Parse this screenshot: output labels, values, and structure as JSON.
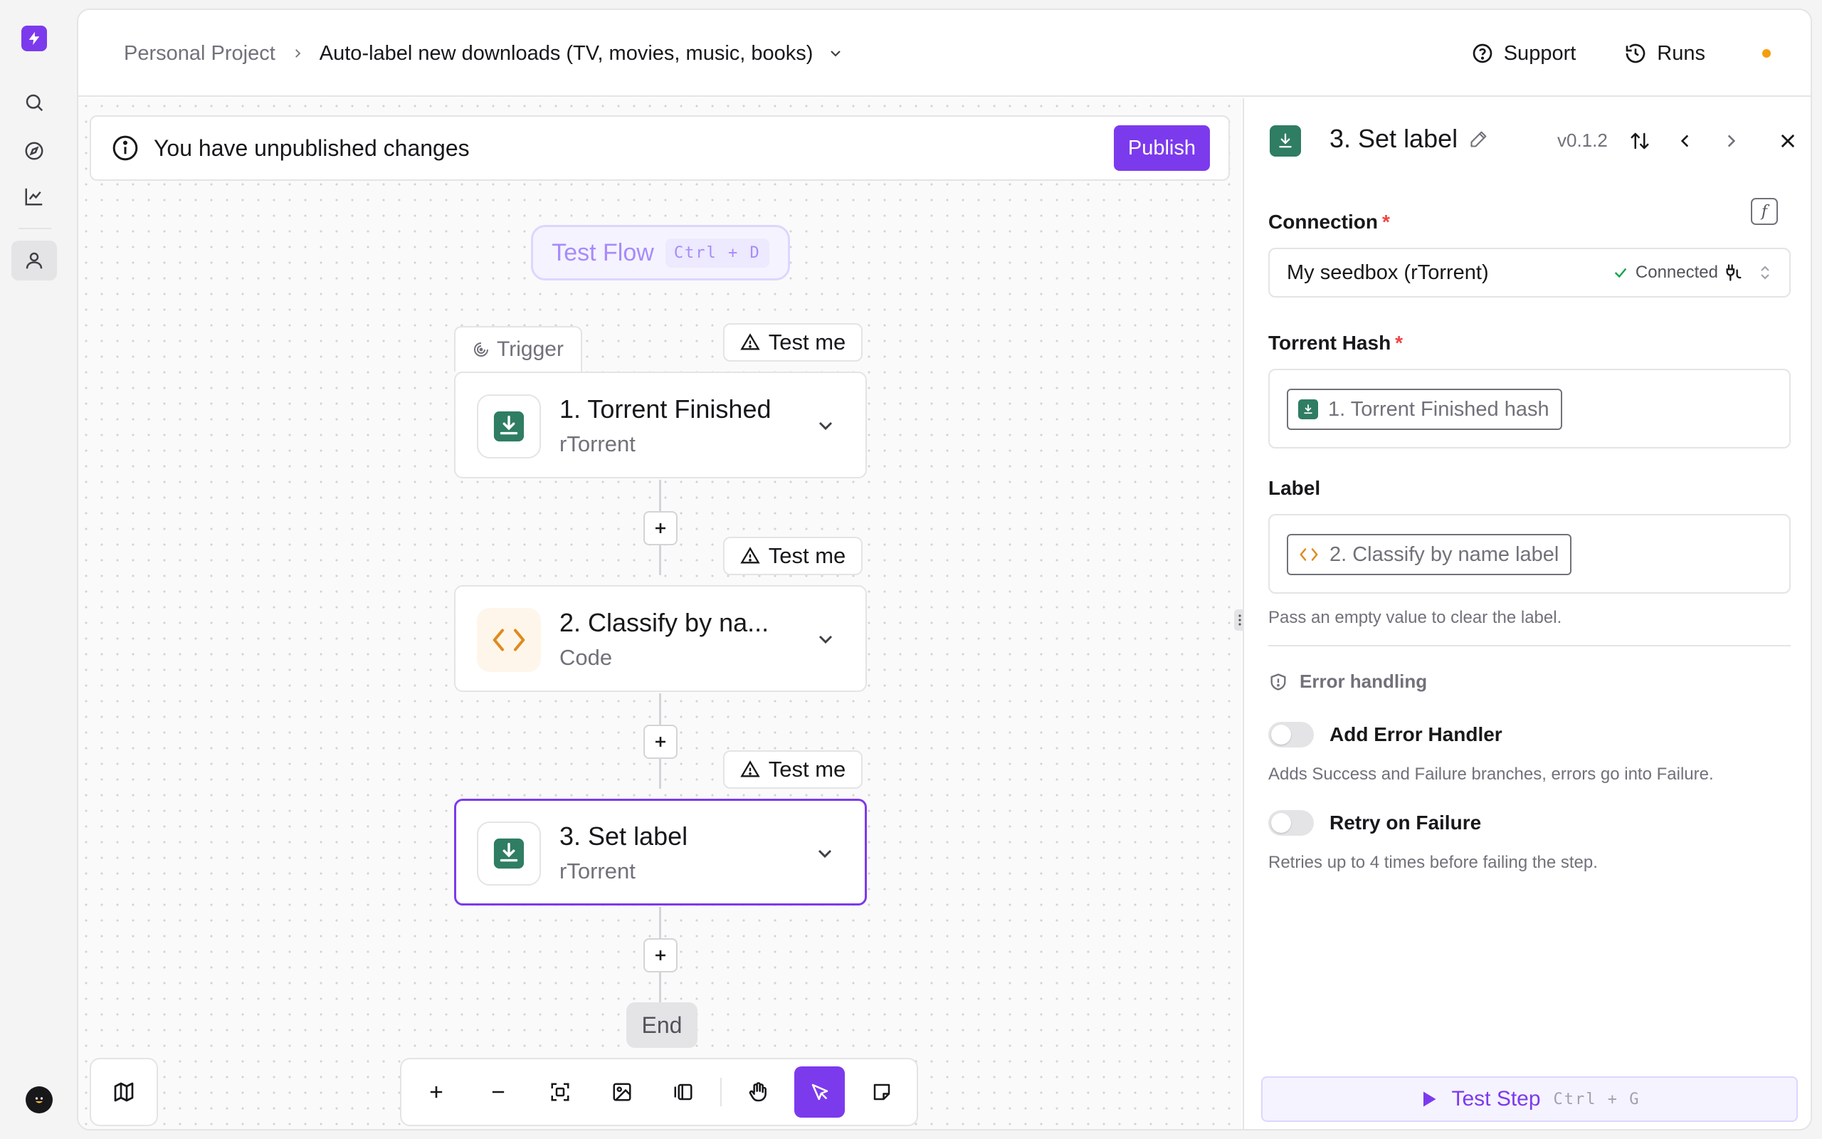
{
  "breadcrumb": {
    "project": "Personal Project",
    "flow_name": "Auto-label new downloads (TV, movies, music, books)"
  },
  "header": {
    "support_label": "Support",
    "runs_label": "Runs"
  },
  "banner": {
    "message": "You have unpublished changes",
    "publish_label": "Publish"
  },
  "canvas": {
    "test_flow_label": "Test Flow",
    "test_flow_shortcut": "Ctrl + D",
    "trigger_tab_label": "Trigger",
    "test_me_label": "Test me",
    "end_label": "End",
    "steps": [
      {
        "title": "1. Torrent Finished",
        "subtitle": "rTorrent",
        "icon": "download-icon"
      },
      {
        "title": "2. Classify by na...",
        "subtitle": "Code",
        "icon": "code-icon"
      },
      {
        "title": "3. Set label",
        "subtitle": "rTorrent",
        "icon": "download-icon",
        "selected": true
      }
    ]
  },
  "panel": {
    "title": "3. Set label",
    "version": "v0.1.2",
    "connection": {
      "label": "Connection",
      "required_mark": "*",
      "value": "My seedbox (rTorrent)",
      "status": "Connected"
    },
    "torrent_hash": {
      "label": "Torrent Hash",
      "required_mark": "*",
      "chip": "1. Torrent Finished hash"
    },
    "label_field": {
      "label": "Label",
      "chip": "2. Classify by name label",
      "hint": "Pass an empty value to clear the label."
    },
    "error_handling": {
      "heading": "Error handling",
      "add_handler_label": "Add Error Handler",
      "add_handler_hint": "Adds Success and Failure branches, errors go into Failure.",
      "retry_label": "Retry on Failure",
      "retry_hint": "Retries up to 4 times before failing the step."
    },
    "test_step_label": "Test Step",
    "test_step_shortcut": "Ctrl + G"
  },
  "colors": {
    "accent": "#7c3aed",
    "rtorrent_green": "#2f7d62",
    "code_orange": "#e08a1e",
    "status_dot": "#f59e0b",
    "connected_green": "#16a34a",
    "required_red": "#ef4444"
  }
}
